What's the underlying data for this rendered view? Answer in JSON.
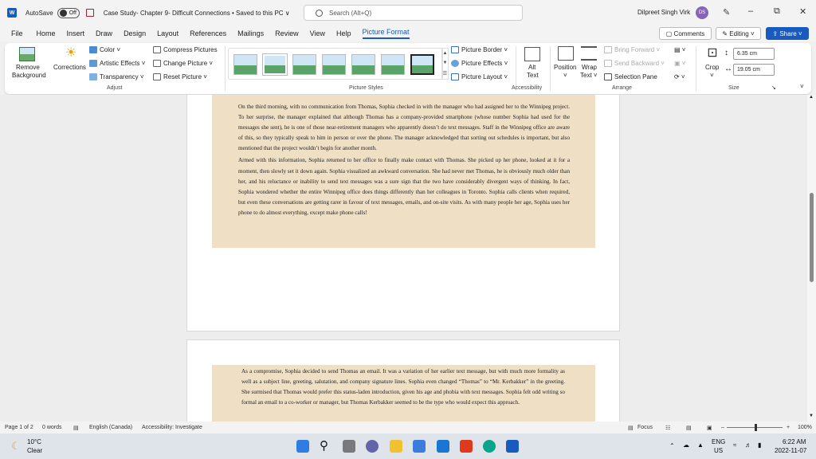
{
  "titlebar": {
    "autosave_label": "AutoSave",
    "autosave_state": "Off",
    "doc_title": "Case Study- Chapter 9- Difficult Connections • Saved to this PC ∨",
    "search_placeholder": "Search (Alt+Q)",
    "user_name": "Dilpreet Singh Virk",
    "user_initials": "DS",
    "minimize": "–",
    "restore": "⧉",
    "close": "✕"
  },
  "tabs": [
    {
      "label": "File"
    },
    {
      "label": "Home"
    },
    {
      "label": "Insert"
    },
    {
      "label": "Draw"
    },
    {
      "label": "Design"
    },
    {
      "label": "Layout"
    },
    {
      "label": "References"
    },
    {
      "label": "Mailings"
    },
    {
      "label": "Review"
    },
    {
      "label": "View"
    },
    {
      "label": "Help"
    },
    {
      "label": "Picture Format"
    }
  ],
  "active_tab": "Picture Format",
  "header_buttons": {
    "comments": "▢ Comments",
    "editing": "✎ Editing ˅",
    "share": "⇪ Share ˅"
  },
  "ribbon": {
    "remove_bg_line1": "Remove",
    "remove_bg_line2": "Background",
    "corrections": "Corrections",
    "color": "Color ˅",
    "artistic": "Artistic Effects ˅",
    "transparency": "Transparency ˅",
    "compress": "Compress Pictures",
    "change_picture": "Change Picture ˅",
    "reset_picture": "Reset Picture  ˅",
    "adjust_label": "Adjust",
    "picture_styles_label": "Picture Styles",
    "picture_border": "Picture Border ˅",
    "picture_effects": "Picture Effects ˅",
    "picture_layout": "Picture Layout ˅",
    "alt_text_line1": "Alt",
    "alt_text_line2": "Text",
    "accessibility_label": "Accessibility",
    "position_line1": "Position",
    "position_line2": "˅",
    "wrap_line1": "Wrap",
    "wrap_line2": "Text ˅",
    "bring_forward": "Bring Forward  ˅",
    "send_backward": "Send Backward  ˅",
    "selection_pane": "Selection Pane",
    "arrange_label": "Arrange",
    "crop_line1": "Crop",
    "crop_line2": "˅",
    "height_value": "6.35 cm",
    "width_value": "19.05 cm",
    "size_label": "Size"
  },
  "document": {
    "page1_paragraphs": [
      "On the third morning, with no communication from Thomas, Sophia checked in with the manager who had assigned her to the Winnipeg project. To her surprise, the manager explained that although Thomas has a company-provided smartphone (whose number Sophia had used for the messages she sent), he is one of those near-retirement managers who apparently doesn’t do text messages. Staff in the Winnipeg office are aware of this, so they typically speak to him in person or over the phone. The manager acknowledged that sorting out schedules is important, but also mentioned that the project wouldn’t begin for another month.",
      "Armed with this information, Sophia returned to her office to finally make contact with Thomas. She picked up her phone, looked at it for a moment, then slowly set it down again. Sophia visualized an awkward conversation. She had never met Thomas, he is obviously much older than her, and his reluctance or inability to send text messages was a sure sign that the two have considerably divergent ways of thinking. In fact, Sophia wondered whether the entire Winnipeg office does things differently than her colleagues in Toronto. Sophia calls clients when required, but even these conversations are getting rarer in favour of text messages, emails, and on-site visits. As with many people her age, Sophia uses her phone to do almost everything, except make phone calls!"
    ],
    "page2_paragraph": "As a compromise, Sophia decided to send Thomas an email. It was a variation of her earlier text message, but with much more formality as well as a subject line, greeting, salutation, and company signature lines. Sophia even changed “Thomas” to “Mr. Kerbakker” in the greeting. She surmised that Thomas would prefer this status-laden introduction, given his age and phobia with text messages. Sophia felt odd writing so formal an email to a co-worker or manager, but Thomas Kerbakker seemed to be the type who would expect this approach."
  },
  "statusbar": {
    "page": "Page 1 of 2",
    "words": "0 words",
    "language": "English (Canada)",
    "accessibility": "Accessibility: Investigate",
    "focus": "Focus",
    "zoom": "100%",
    "minus": "–",
    "plus": "+"
  },
  "taskbar": {
    "temp": "10°C",
    "weather": "Clear",
    "lang1": "ENG",
    "lang2": "US",
    "time": "6:22 AM",
    "date": "2022-11-07"
  },
  "colors": {
    "accent": "#185abd",
    "textbox_fill": "#efdfc5"
  }
}
